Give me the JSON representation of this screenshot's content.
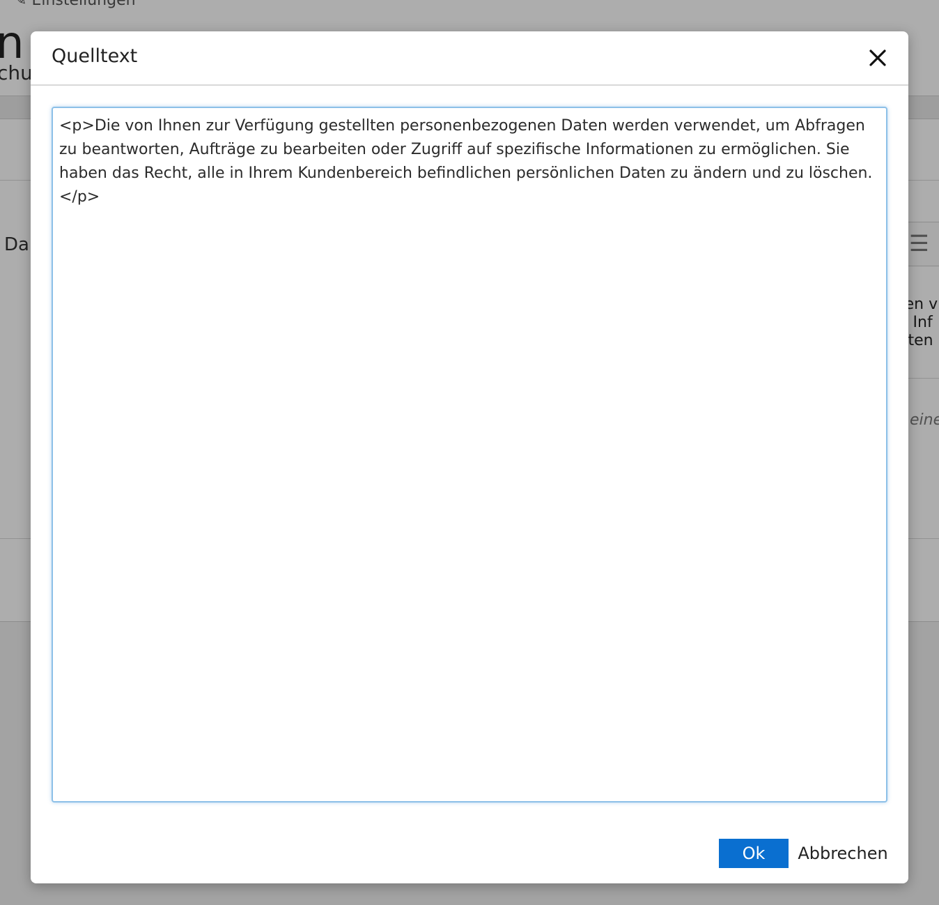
{
  "background": {
    "breadcrumb": "Einstellungen",
    "title_fragment": "n",
    "subtitle_fragment": "chu",
    "field_label_fragment": "Da",
    "editor_lines": [
      "ten v",
      "e Inf",
      "aten"
    ],
    "hint_fragment": "eine"
  },
  "dialog": {
    "title": "Quelltext",
    "source_text": "<p>Die von Ihnen zur Verfügung gestellten personenbezogenen Daten werden verwendet, um Abfragen zu beantworten, Aufträge zu bearbeiten oder Zugriff auf spezifische Informationen zu ermöglichen. Sie haben das Recht, alle in Ihrem Kundenbereich befindlichen persönlichen Daten zu ändern und zu löschen.</p>",
    "ok_label": "Ok",
    "cancel_label": "Abbrechen"
  },
  "colors": {
    "primary": "#0a6fd0",
    "focus_border": "#8cc0e8",
    "overlay": "rgba(0,0,0,0.32)"
  },
  "icons": {
    "close": "close-icon",
    "menu": "hamburger-menu-icon",
    "breadcrumb": "pencil-icon"
  }
}
